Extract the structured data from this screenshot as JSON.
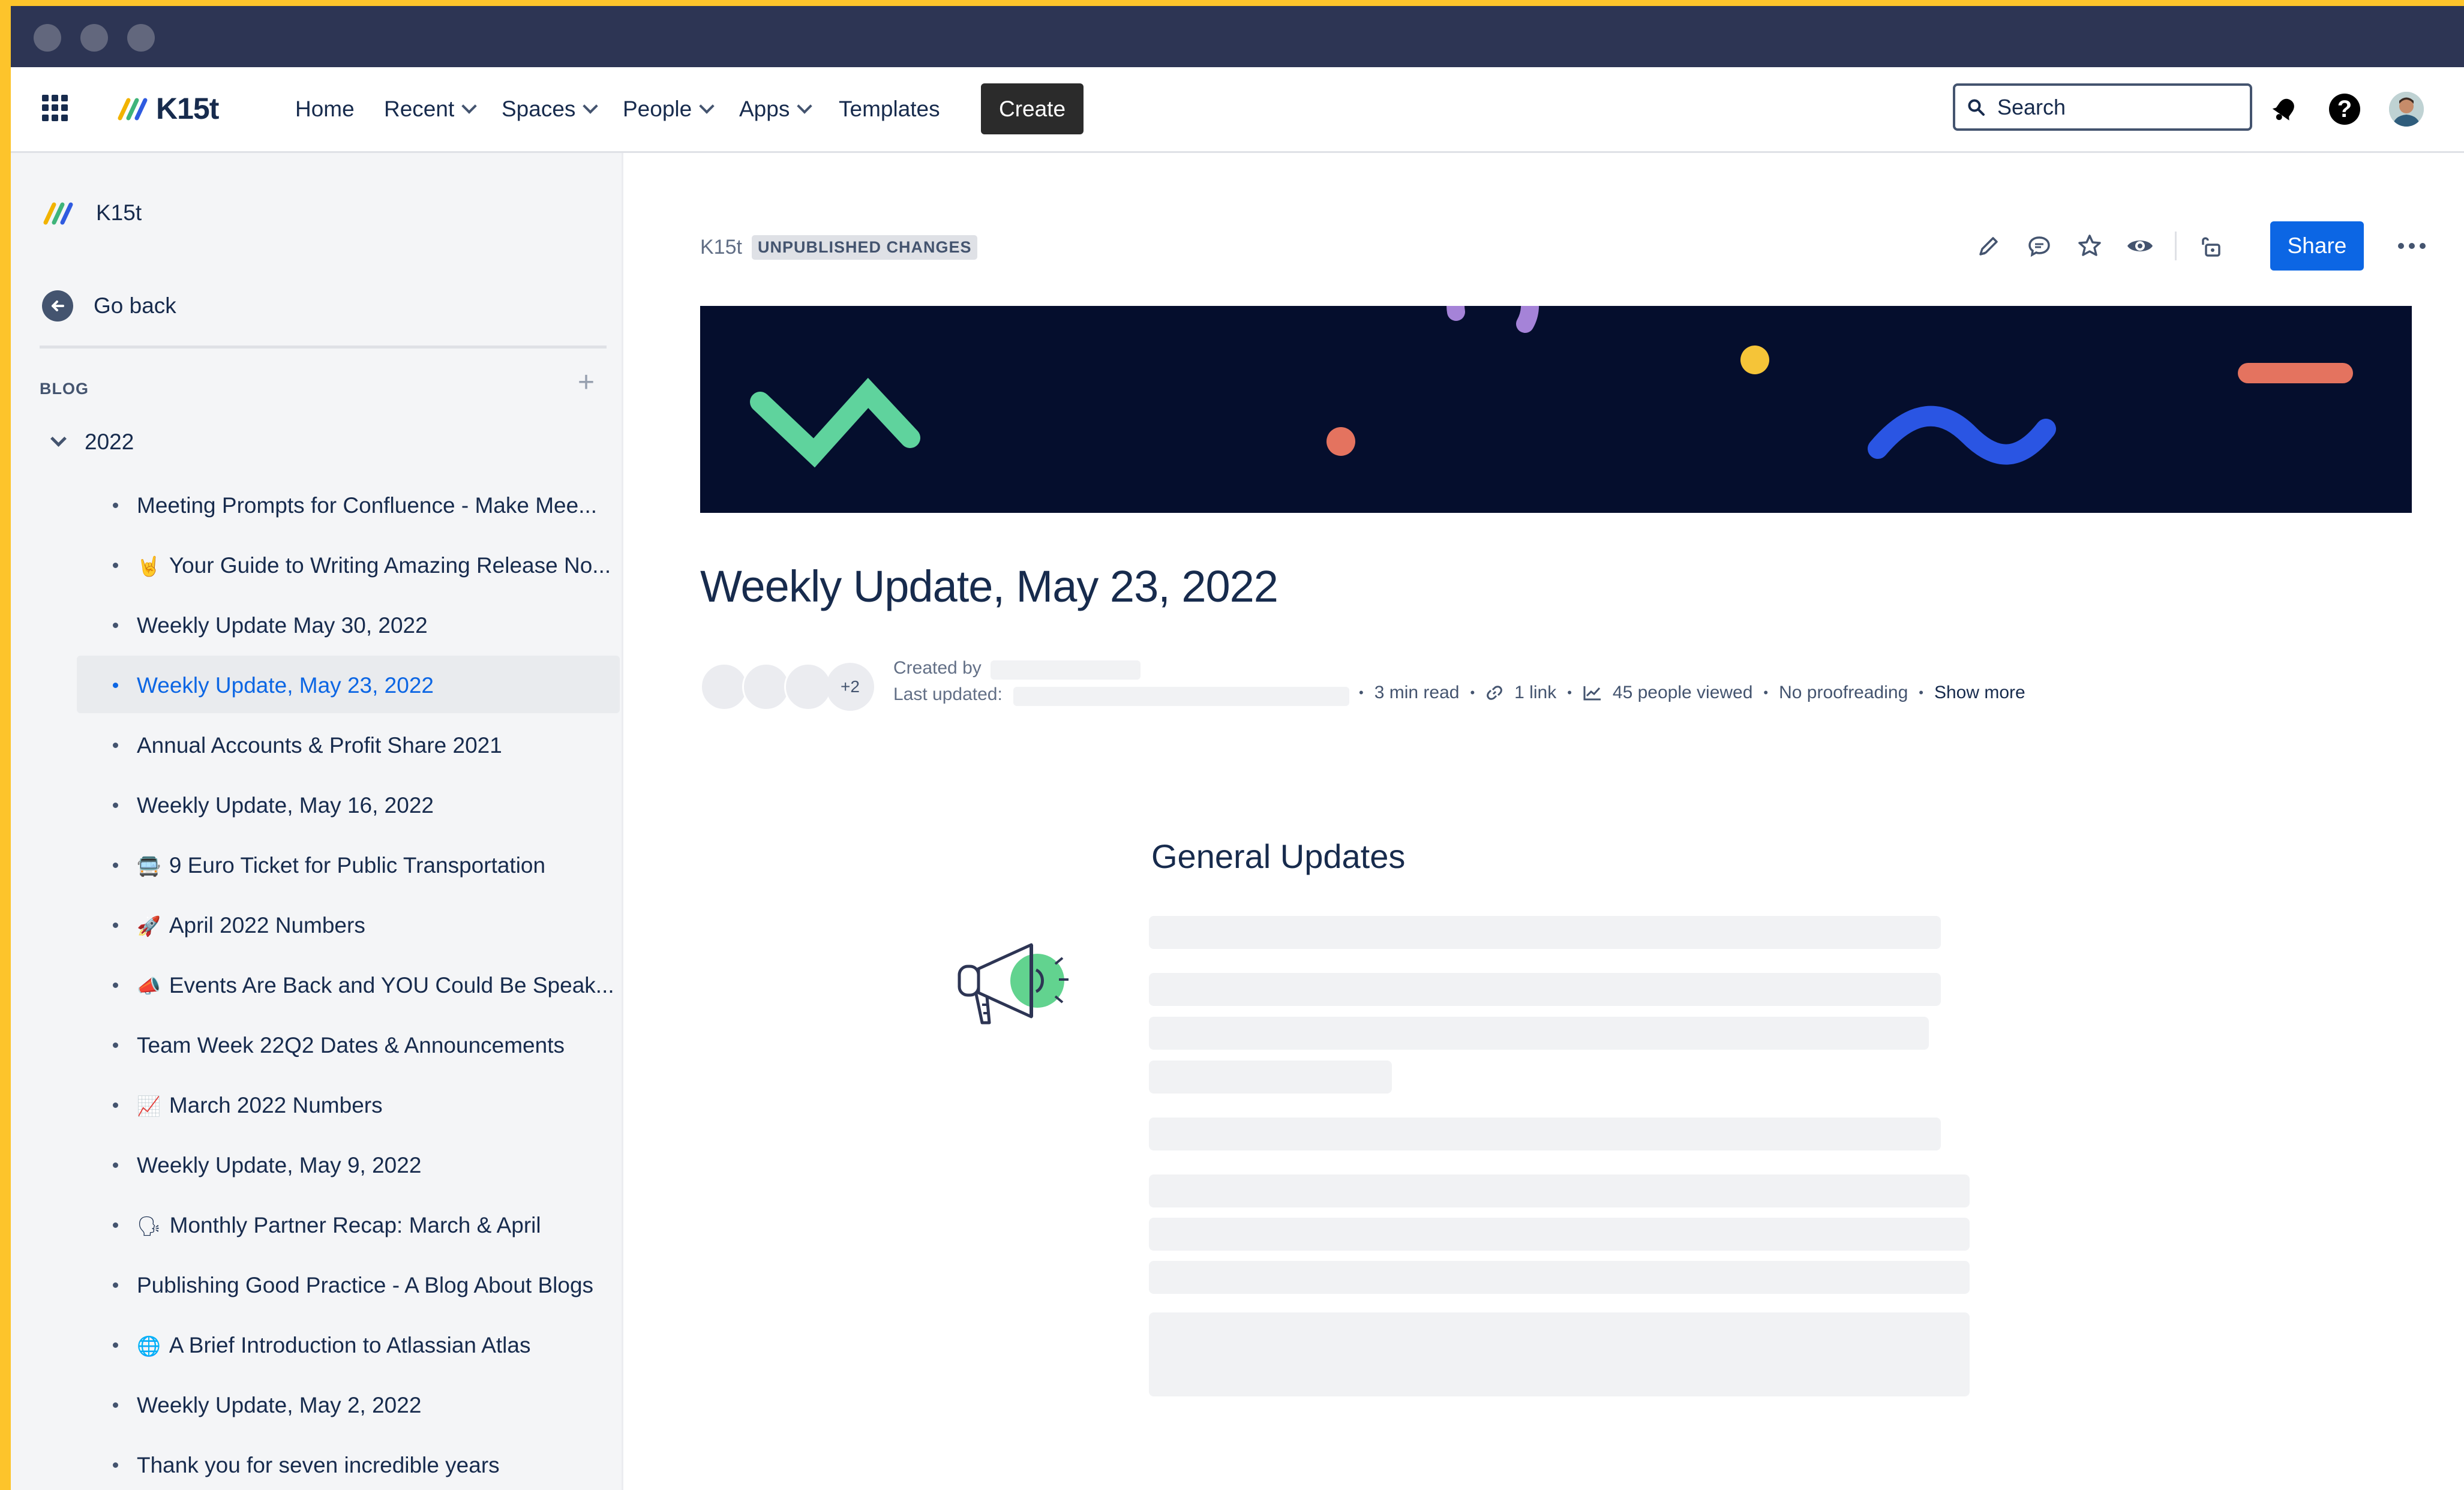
{
  "nav": {
    "logo_text": "K15t",
    "items": [
      {
        "label": "Home",
        "dropdown": false
      },
      {
        "label": "Recent",
        "dropdown": true
      },
      {
        "label": "Spaces",
        "dropdown": true
      },
      {
        "label": "People",
        "dropdown": true
      },
      {
        "label": "Apps",
        "dropdown": true
      },
      {
        "label": "Templates",
        "dropdown": false
      }
    ],
    "create_label": "Create",
    "search_placeholder": "Search",
    "icons": [
      "app-switcher-icon",
      "notification-bell-icon",
      "help-icon",
      "user-avatar"
    ]
  },
  "sidebar": {
    "space_name": "K15t",
    "back_label": "Go back",
    "section_label": "BLOG",
    "add_icon": "plus-icon",
    "year": "2022",
    "posts": [
      {
        "emoji": "",
        "label": "Meeting Prompts for Confluence - Make Mee...",
        "active": false
      },
      {
        "emoji": "🤘",
        "label": "Your Guide to Writing Amazing Release No...",
        "active": false
      },
      {
        "emoji": "",
        "label": "Weekly Update May 30, 2022",
        "active": false
      },
      {
        "emoji": "",
        "label": "Weekly Update, May 23, 2022",
        "active": true
      },
      {
        "emoji": "",
        "label": "Annual Accounts & Profit Share 2021",
        "active": false
      },
      {
        "emoji": "",
        "label": "Weekly Update, May 16, 2022",
        "active": false
      },
      {
        "emoji": "🚍",
        "label": "9 Euro Ticket for Public Transportation",
        "active": false
      },
      {
        "emoji": "🚀",
        "label": "April 2022 Numbers",
        "active": false
      },
      {
        "emoji": "📣",
        "label": "Events Are Back and YOU Could Be Speak...",
        "active": false
      },
      {
        "emoji": "",
        "label": "Team Week 22Q2 Dates & Announcements",
        "active": false
      },
      {
        "emoji": "📈",
        "label": "March 2022 Numbers",
        "active": false
      },
      {
        "emoji": "",
        "label": "Weekly Update, May 9, 2022",
        "active": false
      },
      {
        "emoji": "🗣",
        "label": "Monthly Partner Recap: March & April",
        "active": false
      },
      {
        "emoji": "",
        "label": "Publishing Good Practice - A Blog About Blogs",
        "active": false
      },
      {
        "emoji": "🌐",
        "label": "A Brief Introduction to Atlassian Atlas",
        "active": false
      },
      {
        "emoji": "",
        "label": "Weekly Update, May 2, 2022",
        "active": false
      },
      {
        "emoji": "",
        "label": "Thank you for seven incredible years",
        "active": false
      }
    ]
  },
  "page": {
    "breadcrumb_space": "K15t",
    "status_lozenge": "UNPUBLISHED CHANGES",
    "share_label": "Share",
    "title": "Weekly Update, May 23, 2022",
    "contributors_extra": "+2",
    "created_by_label": "Created by",
    "last_updated_label": "Last updated:",
    "read_time": "3 min read",
    "links": "1 link",
    "views": "45 people viewed",
    "proofreading": "No proofreading",
    "show_more": "Show more",
    "section_heading": "General Updates"
  },
  "colors": {
    "accent": "#0c66e4",
    "banner_bg": "#050e2d",
    "frame": "#fdc42b",
    "titlebar": "#2d3554"
  }
}
